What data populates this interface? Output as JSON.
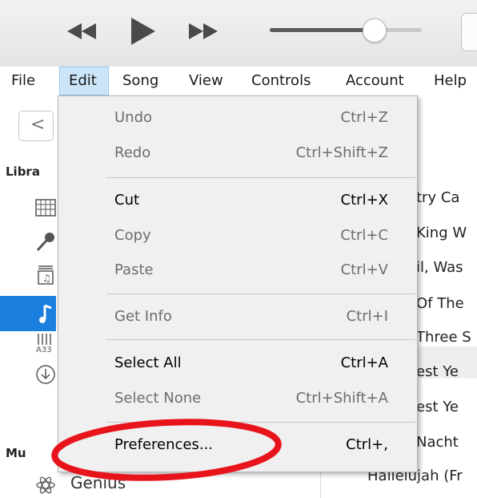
{
  "toolbar": {
    "rewind_icon": "rewind-icon",
    "play_icon": "play-icon",
    "forward_icon": "fast-forward-icon",
    "volume_level": 0.64
  },
  "menubar": {
    "items": [
      "File",
      "Edit",
      "Song",
      "View",
      "Controls",
      "Account",
      "Help"
    ],
    "active": "Edit"
  },
  "sidebar": {
    "back_glyph": "<",
    "library_heading": "Libra",
    "music_heading": "Mu",
    "genius_label": "Genius",
    "icons": [
      "grid-icon",
      "microphone-icon",
      "music-list-icon",
      "music-note-icon",
      "composer-icon",
      "download-icon",
      "genius-icon"
    ]
  },
  "songs": [
    "try Ca",
    "King W",
    "il, Was",
    "Of The",
    "Three S",
    "est Ye",
    "est Ye",
    "Nacht",
    "Hallelujah (Fr"
  ],
  "edit_menu": {
    "items": [
      {
        "label": "Undo",
        "shortcut": "Ctrl+Z",
        "enabled": false
      },
      {
        "label": "Redo",
        "shortcut": "Ctrl+Shift+Z",
        "enabled": false
      },
      {
        "label": "Cut",
        "shortcut": "Ctrl+X",
        "enabled": true
      },
      {
        "label": "Copy",
        "shortcut": "Ctrl+C",
        "enabled": false
      },
      {
        "label": "Paste",
        "shortcut": "Ctrl+V",
        "enabled": false
      },
      {
        "label": "Get Info",
        "shortcut": "Ctrl+I",
        "enabled": false
      },
      {
        "label": "Select All",
        "shortcut": "Ctrl+A",
        "enabled": true
      },
      {
        "label": "Select None",
        "shortcut": "Ctrl+Shift+A",
        "enabled": false
      },
      {
        "label": "Preferences...",
        "shortcut": "Ctrl+,",
        "enabled": true
      }
    ]
  },
  "colors": {
    "highlight_ellipse": "#e8141c",
    "selection_blue": "#1b7fe0",
    "menu_bg": "#f0f0f0",
    "active_menu_bg": "#cce4f7"
  }
}
